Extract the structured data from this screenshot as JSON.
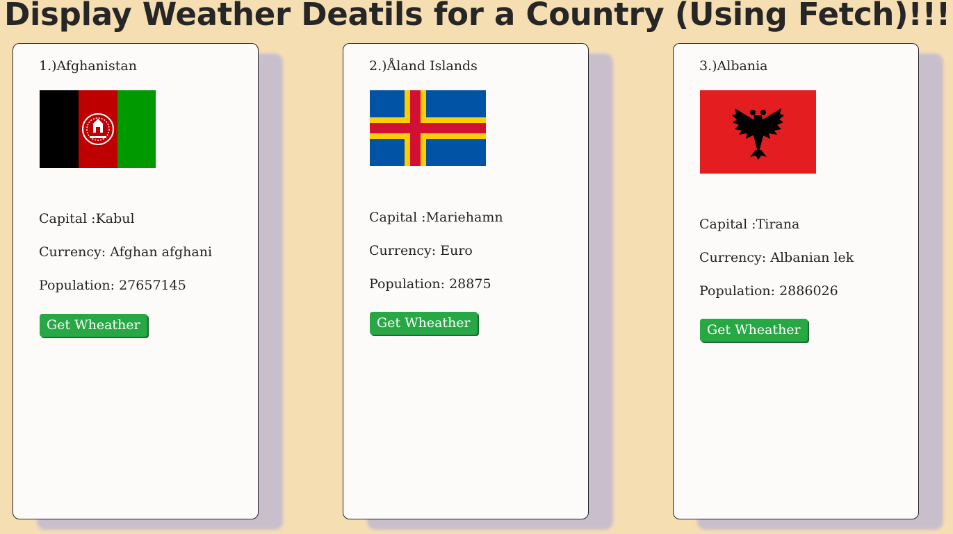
{
  "page": {
    "title": "Display Weather Deatils for a Country (Using Fetch)!!!"
  },
  "countries": [
    {
      "title": "1.)Afghanistan",
      "flag_icon": "afghanistan-flag",
      "capital": "Capital :Kabul",
      "currency": "Currency: Afghan afghani",
      "population": "Population: 27657145",
      "button_label": "Get Wheather",
      "flag_colors": [
        "#000000",
        "#be0000",
        "#009900"
      ]
    },
    {
      "title": "2.)Åland Islands",
      "flag_icon": "aland-islands-flag",
      "capital": "Capital :Mariehamn",
      "currency": "Currency: Euro",
      "population": "Population: 28875",
      "button_label": "Get Wheather",
      "flag_colors": [
        "#0053a5",
        "#ffce00",
        "#d21034"
      ]
    },
    {
      "title": "3.)Albania",
      "flag_icon": "albania-flag",
      "capital": "Capital :Tirana",
      "currency": "Currency: Albanian lek",
      "population": "Population: 2886026",
      "button_label": "Get Wheather",
      "flag_colors": [
        "#e41e20",
        "#000000"
      ]
    }
  ]
}
